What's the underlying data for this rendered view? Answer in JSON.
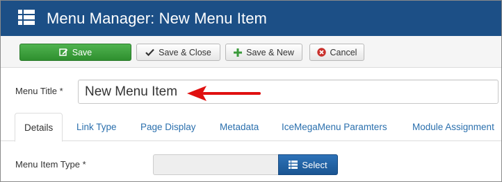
{
  "header": {
    "title": "Menu Manager: New Menu Item",
    "icon": "list-icon",
    "background": "#1c4f86"
  },
  "toolbar": {
    "save_label": "Save",
    "save_close_label": "Save & Close",
    "save_new_label": "Save & New",
    "cancel_label": "Cancel",
    "save_color": "#3aa03a",
    "cancel_icon_color": "#c9302c"
  },
  "form": {
    "title_label": "Menu Title *",
    "title_value": "New Menu Item",
    "annotation_arrow_color": "#e01010",
    "item_type_label": "Menu Item Type *",
    "item_type_value": "",
    "select_label": "Select"
  },
  "tabs": [
    {
      "label": "Details",
      "active": true
    },
    {
      "label": "Link Type",
      "active": false
    },
    {
      "label": "Page Display",
      "active": false
    },
    {
      "label": "Metadata",
      "active": false
    },
    {
      "label": "IceMegaMenu Paramters",
      "active": false
    },
    {
      "label": "Module Assignment",
      "active": false
    }
  ]
}
